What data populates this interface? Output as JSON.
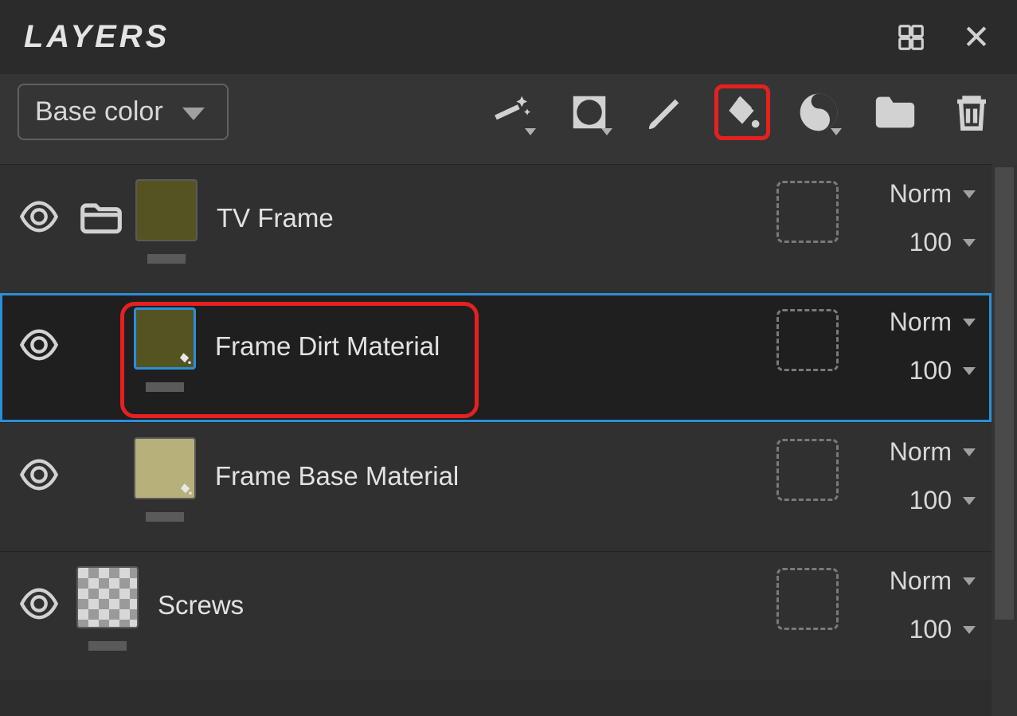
{
  "panel": {
    "title": "LAYERS"
  },
  "channel_selector": {
    "selected": "Base color"
  },
  "toolbar_icons": {
    "effect": "effect-icon",
    "mask": "mask-icon",
    "paint": "paint-icon",
    "fill": "fill-icon",
    "smart": "smart-material-icon",
    "folder": "folder-icon",
    "delete": "trash-icon"
  },
  "layers": [
    {
      "name": "TV Frame",
      "type": "folder",
      "thumb_color": "#555322",
      "blend_mode": "Norm",
      "opacity": "100",
      "selected": false,
      "has_fill_badge": false
    },
    {
      "name": "Frame Dirt Material",
      "type": "fill",
      "thumb_color": "#555322",
      "blend_mode": "Norm",
      "opacity": "100",
      "selected": true,
      "has_fill_badge": true
    },
    {
      "name": "Frame Base Material",
      "type": "fill",
      "thumb_color": "#b7b07a",
      "blend_mode": "Norm",
      "opacity": "100",
      "selected": false,
      "has_fill_badge": true
    },
    {
      "name": "Screws",
      "type": "folder",
      "thumb_color": "checker",
      "blend_mode": "Norm",
      "opacity": "100",
      "selected": false,
      "has_fill_badge": false
    }
  ],
  "annotations": {
    "highlight_fill_tool": true,
    "highlight_selected_layer_label": true
  }
}
